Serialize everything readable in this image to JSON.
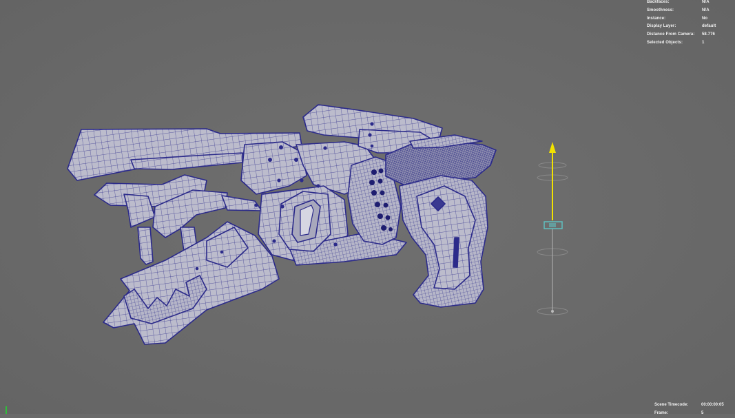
{
  "hud": {
    "rows": [
      {
        "label": "Backfaces:",
        "value": "N/A"
      },
      {
        "label": "Smoothness:",
        "value": "N/A"
      },
      {
        "label": "Instance:",
        "value": "No"
      },
      {
        "label": "Display Layer:",
        "value": "default"
      },
      {
        "label": "Distance From Camera:",
        "value": "58.776"
      },
      {
        "label": "Selected Objects:",
        "value": "1"
      }
    ],
    "bottom_rows": [
      {
        "label": "Scene Timecode:",
        "value": "00:00:00:05"
      },
      {
        "label": "Frame:",
        "value": "5"
      }
    ]
  },
  "colors": {
    "viewport_bg": "#6a6a6a",
    "mesh_fill": "#b9b9c9",
    "wire": "#2b2a8a",
    "manipulator_up": "#f2e200",
    "manipulator_handle": "#5fc0c0",
    "axis_y": "#2fbf3a"
  },
  "icons": {
    "manipulator": "move-manipulator-icon",
    "axis": "world-axis-icon"
  }
}
